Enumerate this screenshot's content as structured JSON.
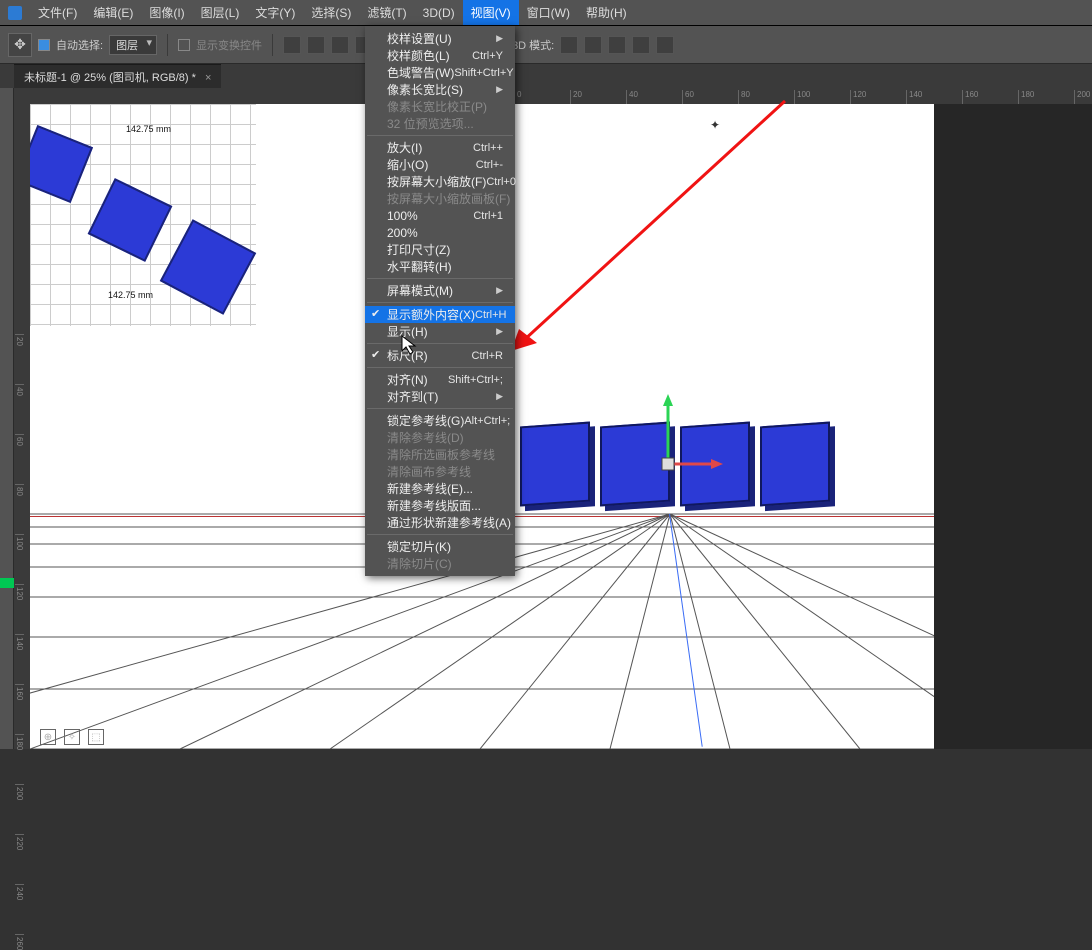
{
  "menubar": {
    "items": [
      "文件(F)",
      "编辑(E)",
      "图像(I)",
      "图层(L)",
      "文字(Y)",
      "选择(S)",
      "滤镜(T)",
      "3D(D)",
      "视图(V)",
      "窗口(W)",
      "帮助(H)"
    ],
    "open_index": 8
  },
  "options": {
    "auto_select_label": "自动选择:",
    "auto_select_value": "图层",
    "transform_controls_label": "显示变换控件",
    "mode3d_label": "3D 模式:"
  },
  "doc_tab": {
    "title": "未标题-1 @ 25% (图司机, RGB/8) *"
  },
  "ruler_h": [
    "0",
    "20",
    "40",
    "60",
    "80",
    "100",
    "120",
    "140",
    "160",
    "180",
    "200"
  ],
  "ruler_v": [
    "20",
    "40",
    "60",
    "80",
    "100",
    "120",
    "140",
    "160",
    "180",
    "200",
    "220",
    "240",
    "260"
  ],
  "preview": {
    "label_top": "142.75 mm",
    "label_bottom": "142.75 mm"
  },
  "marker_glyph": "✦",
  "dropdown": {
    "groups": [
      [
        {
          "label": "校样设置(U)",
          "submenu": true
        },
        {
          "label": "校样颜色(L)",
          "shortcut": "Ctrl+Y"
        },
        {
          "label": "色域警告(W)",
          "shortcut": "Shift+Ctrl+Y"
        },
        {
          "label": "像素长宽比(S)",
          "submenu": true
        },
        {
          "label": "像素长宽比校正(P)",
          "disabled": true
        },
        {
          "label": "32 位预览选项...",
          "disabled": true
        }
      ],
      [
        {
          "label": "放大(I)",
          "shortcut": "Ctrl++"
        },
        {
          "label": "缩小(O)",
          "shortcut": "Ctrl+-"
        },
        {
          "label": "按屏幕大小缩放(F)",
          "shortcut": "Ctrl+0"
        },
        {
          "label": "按屏幕大小缩放画板(F)",
          "disabled": true
        },
        {
          "label": "100%",
          "shortcut": "Ctrl+1"
        },
        {
          "label": "200%"
        },
        {
          "label": "打印尺寸(Z)"
        },
        {
          "label": "水平翻转(H)"
        }
      ],
      [
        {
          "label": "屏幕模式(M)",
          "submenu": true
        }
      ],
      [
        {
          "label": "显示额外内容(X)",
          "shortcut": "Ctrl+H",
          "checked": true,
          "highlight": true
        },
        {
          "label": "显示(H)",
          "submenu": true
        }
      ],
      [
        {
          "label": "标尺(R)",
          "shortcut": "Ctrl+R",
          "checked": true
        }
      ],
      [
        {
          "label": "对齐(N)",
          "shortcut": "Shift+Ctrl+;"
        },
        {
          "label": "对齐到(T)",
          "submenu": true
        }
      ],
      [
        {
          "label": "锁定参考线(G)",
          "shortcut": "Alt+Ctrl+;"
        },
        {
          "label": "清除参考线(D)",
          "disabled": true
        },
        {
          "label": "清除所选画板参考线",
          "disabled": true
        },
        {
          "label": "清除画布参考线",
          "disabled": true
        },
        {
          "label": "新建参考线(E)..."
        },
        {
          "label": "新建参考线版面..."
        },
        {
          "label": "通过形状新建参考线(A)"
        }
      ],
      [
        {
          "label": "锁定切片(K)"
        },
        {
          "label": "清除切片(C)",
          "disabled": true
        }
      ]
    ]
  }
}
